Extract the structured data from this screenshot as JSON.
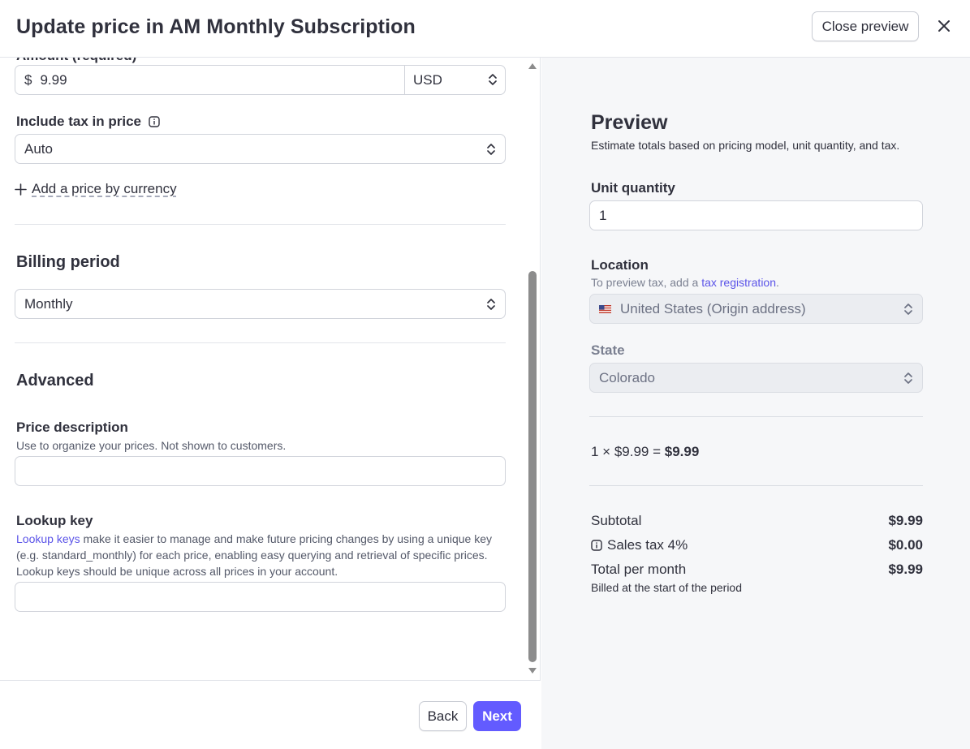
{
  "header": {
    "title": "Update price in AM Monthly Subscription",
    "close_preview_label": "Close preview"
  },
  "form": {
    "amount_cut_label": "Amount (required)",
    "currency_symbol": "$",
    "amount_value": "9.99",
    "currency": "USD",
    "include_tax_label": "Include tax in price",
    "include_tax_value": "Auto",
    "add_price_currency_label": "Add a price by currency",
    "billing_period_heading": "Billing period",
    "billing_period_value": "Monthly",
    "advanced_heading": "Advanced",
    "price_description_label": "Price description",
    "price_description_help": "Use to organize your prices. Not shown to customers.",
    "price_description_value": "",
    "lookup_key_label": "Lookup key",
    "lookup_key_help_link": "Lookup keys",
    "lookup_key_help_text": " make it easier to manage and make future pricing changes by using a unique key (e.g. standard_monthly) for each price, enabling easy querying and retrieval of specific prices. Lookup keys should be unique across all prices in your account.",
    "lookup_key_value": ""
  },
  "footer": {
    "back_label": "Back",
    "next_label": "Next"
  },
  "preview": {
    "title": "Preview",
    "subtitle": "Estimate totals based on pricing model, unit quantity, and tax.",
    "unit_quantity_label": "Unit quantity",
    "unit_quantity_value": "1",
    "location_label": "Location",
    "location_help_prefix": "To preview tax, add a ",
    "location_help_link": "tax registration",
    "location_help_suffix": ".",
    "location_value": "United States (Origin address)",
    "state_label": "State",
    "state_value": "Colorado",
    "calc_expression": "1 × $9.99 = ",
    "calc_result": "$9.99",
    "subtotal_label": "Subtotal",
    "subtotal_value": "$9.99",
    "sales_tax_label": "Sales tax 4%",
    "sales_tax_value": "$0.00",
    "total_label": "Total per month",
    "total_value": "$9.99",
    "billed_note": "Billed at the start of the period"
  },
  "colors": {
    "accent": "#635bff",
    "link": "#5b54e8",
    "text": "#30313d",
    "preview_bg": "#f6f7f9"
  },
  "icons": {
    "close": "close-icon",
    "info": "info-icon",
    "plus": "plus-icon",
    "chevron": "chevron-updown-icon",
    "flag": "us-flag-icon"
  }
}
